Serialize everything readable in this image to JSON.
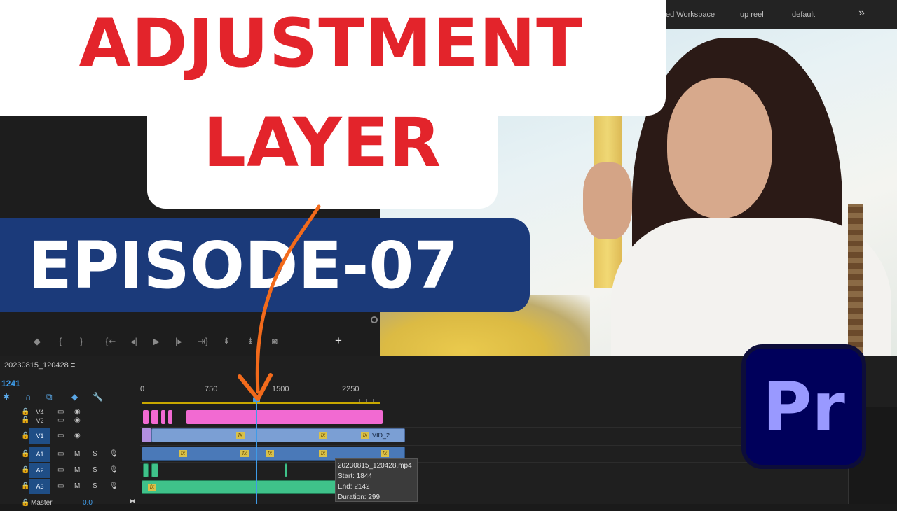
{
  "workspace_bar": {
    "items": [
      "ed Workspace",
      "up reel",
      "default"
    ],
    "more_label": "»"
  },
  "thumbnail": {
    "title_line1": "ADJUSTMENT",
    "title_line2": "LAYER",
    "episode": "EPISODE-07",
    "logo_text": "Pr",
    "colors": {
      "title": "#e3242b",
      "episode_bg": "#1b3a7a",
      "arrow": "#f26a1b",
      "logo_bg": "#00005b",
      "logo_text": "#9999ff"
    }
  },
  "transport": {
    "add_label": "+"
  },
  "timeline": {
    "sequence_name": "20230815_120428 ≡",
    "timecode": "1241",
    "ruler_labels": [
      "0",
      "750",
      "1500",
      "2250"
    ],
    "tracks": [
      {
        "name": "V4",
        "type": "video"
      },
      {
        "name": "V2",
        "type": "video"
      },
      {
        "name": "V1",
        "type": "video"
      },
      {
        "name": "A1",
        "type": "audio"
      },
      {
        "name": "A2",
        "type": "audio"
      },
      {
        "name": "A3",
        "type": "audio"
      }
    ],
    "master": {
      "label": "Master",
      "value": "0.0"
    },
    "track_buttons": {
      "mute": "M",
      "solo": "S"
    },
    "clip_labels": {
      "vid": "VID_2",
      "fx": "fx"
    },
    "tooltip": {
      "file": "20230815_120428.mp4",
      "start": "Start: 1844",
      "end": "End: 2142",
      "duration": "Duration: 299"
    }
  }
}
